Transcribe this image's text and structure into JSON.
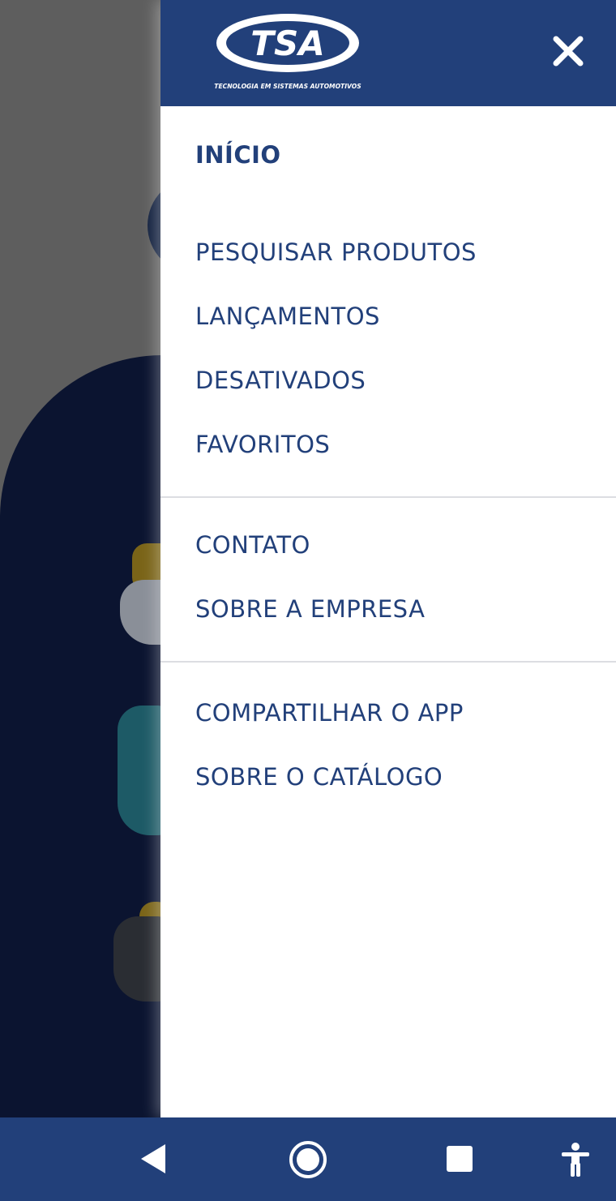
{
  "header": {
    "logo_text": "TSA",
    "logo_tagline": "TECNOLOGIA EM SISTEMAS AUTOMOTIVOS",
    "brand_color": "#22407a"
  },
  "menu": {
    "inicio": "INÍCIO",
    "pesquisar": "PESQUISAR PRODUTOS",
    "lancamentos": "LANÇAMENTOS",
    "desativados": "DESATIVADOS",
    "favoritos": "FAVORITOS",
    "contato": "CONTATO",
    "sobre_empresa": "SOBRE A EMPRESA",
    "compartilhar": "COMPARTILHAR O APP",
    "sobre_catalogo": "SOBRE O CATÁLOGO"
  },
  "icons": {
    "close": "close-icon",
    "back": "back-icon",
    "home": "home-icon",
    "recents": "recents-icon",
    "accessibility": "accessibility-icon"
  }
}
